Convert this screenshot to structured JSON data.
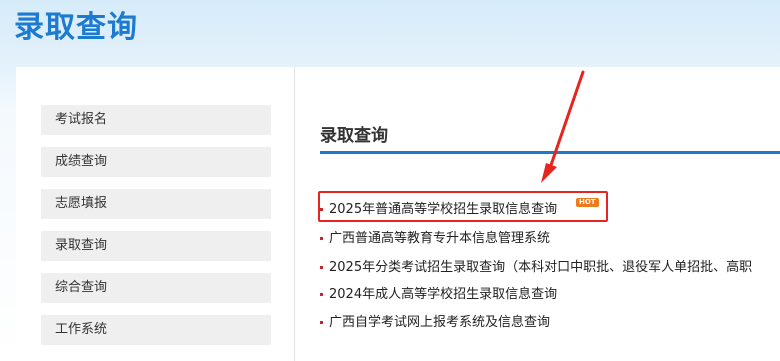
{
  "page": {
    "title": "录取查询"
  },
  "sidebar": {
    "items": [
      {
        "label": "考试报名"
      },
      {
        "label": "成绩查询"
      },
      {
        "label": "志愿填报"
      },
      {
        "label": "录取查询"
      },
      {
        "label": "综合查询"
      },
      {
        "label": "工作系统"
      }
    ]
  },
  "main": {
    "section_title": "录取查询",
    "links": [
      {
        "label": "2025年普通高等学校招生录取信息查询",
        "badge": "HOT",
        "highlighted": true
      },
      {
        "label": "广西普通高等教育专升本信息管理系统"
      },
      {
        "label": "2025年分类考试招生录取查询（本科对口中职批、退役军人单招批、高职"
      },
      {
        "label": "2024年成人高等学校招生录取信息查询"
      },
      {
        "label": "广西自学考试网上报考系统及信息查询"
      }
    ]
  },
  "colors": {
    "title_blue": "#1c7ad0",
    "rule_blue": "#1f78c8",
    "annotation_red": "#e52620",
    "bullet_red": "#c1272d",
    "badge_orange": "#f07a1a"
  }
}
